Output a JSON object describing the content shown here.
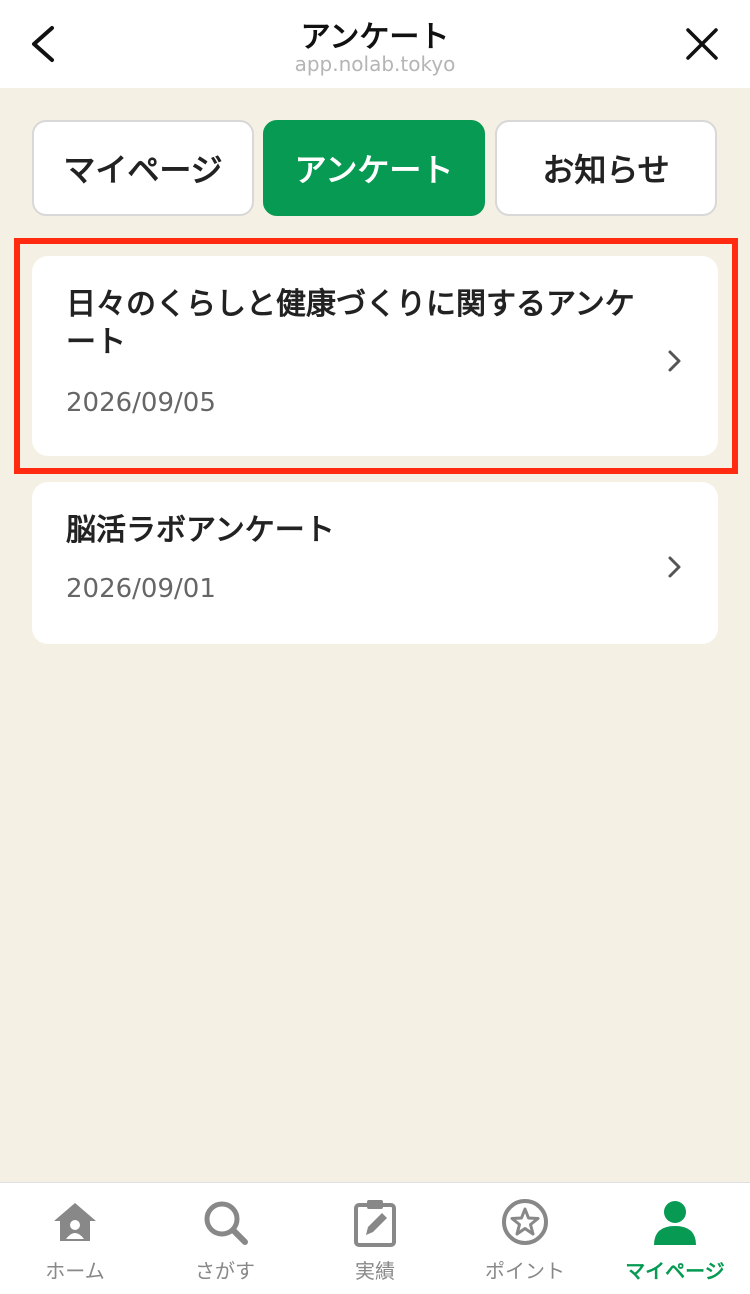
{
  "header": {
    "title": "アンケート",
    "url": "app.nolab.tokyo"
  },
  "tabs": [
    {
      "label": "マイページ",
      "active": false
    },
    {
      "label": "アンケート",
      "active": true
    },
    {
      "label": "お知らせ",
      "active": false
    }
  ],
  "surveys": [
    {
      "title": "日々のくらしと健康づくりに関するアンケート",
      "date": "2026/09/05"
    },
    {
      "title": "脳活ラボアンケート",
      "date": "2026/09/01"
    }
  ],
  "bottom_nav": [
    {
      "label": "ホーム",
      "icon": "home-icon"
    },
    {
      "label": "さがす",
      "icon": "search-icon"
    },
    {
      "label": "実績",
      "icon": "edit-clipboard-icon"
    },
    {
      "label": "ポイント",
      "icon": "star-circle-icon"
    },
    {
      "label": "マイページ",
      "icon": "person-icon",
      "active": true
    }
  ],
  "colors": {
    "accent": "#069a52",
    "background": "#f4f0e4",
    "highlight": "#ff2a10"
  }
}
